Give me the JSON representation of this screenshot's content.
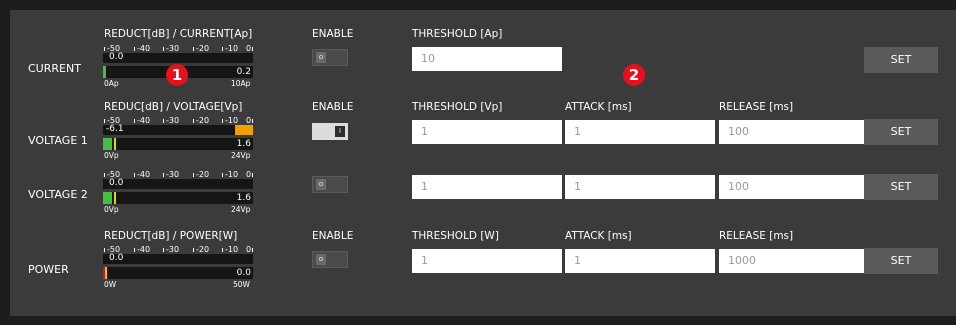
{
  "rows": [
    {
      "label": "CURRENT",
      "meter_title": "REDUCT[dB] / CURRENT[Ap]",
      "reduction_value": "0.0",
      "level_value": "0.2",
      "axis_min": "0Ap",
      "axis_max": "10Ap",
      "enable_header": "ENABLE",
      "enable_on": false,
      "threshold_label": "THRESHOLD [Ap]",
      "threshold_value": "10",
      "set_label": "SET"
    },
    {
      "label": "VOLTAGE 1",
      "meter_title": "REDUC[dB] / VOLTAGE[Vp]",
      "reduction_value": "-6.1",
      "level_value": "1.6",
      "axis_min": "0Vp",
      "axis_max": "24Vp",
      "enable_header": "ENABLE",
      "enable_on": true,
      "threshold_label": "THRESHOLD [Vp]",
      "threshold_value": "1",
      "attack_label": "ATTACK [ms]",
      "attack_value": "1",
      "release_label": "RELEASE [ms]",
      "release_value": "100",
      "set_label": "SET"
    },
    {
      "label": "VOLTAGE 2",
      "reduction_value": "0.0",
      "level_value": "1.6",
      "axis_min": "0Vp",
      "axis_max": "24Vp",
      "enable_on": false,
      "threshold_value": "1",
      "attack_value": "1",
      "release_value": "100",
      "set_label": "SET"
    },
    {
      "label": "POWER",
      "meter_title": "REDUCT[dB] / POWER[W]",
      "reduction_value": "0.0",
      "level_value": "0.0",
      "axis_min": "0W",
      "axis_max": "50W",
      "enable_header": "ENABLE",
      "enable_on": false,
      "threshold_label": "THRESHOLD [W]",
      "threshold_value": "1",
      "attack_label": "ATTACK [ms]",
      "attack_value": "1",
      "release_label": "RELEASE [ms]",
      "release_value": "1000",
      "set_label": "SET"
    }
  ],
  "scale_ticks": [
    "-50",
    "-40",
    "-30",
    "-20",
    "-10",
    "0"
  ],
  "toggle_off_glyph": "o",
  "toggle_on_glyph": "I",
  "badges": [
    "1",
    "2"
  ],
  "colors": {
    "panel": "#3b3b3b",
    "meter_background": "#151515",
    "level_green": "#3fc23f",
    "peak_yellow": "#e8d000",
    "peak_red": "#e01010",
    "reduction_orange": "#f0a000",
    "badge_red": "#e8101a",
    "set_button": "#5a5a5a"
  }
}
